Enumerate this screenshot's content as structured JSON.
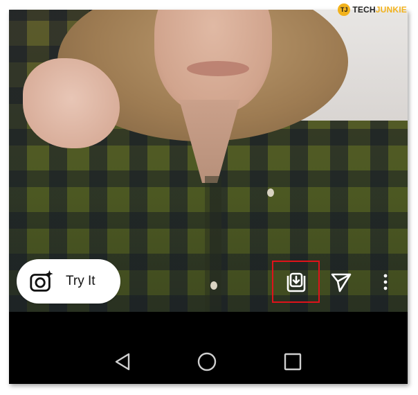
{
  "watermark": {
    "badge": "TJ",
    "prefix": "TECH",
    "suffix": "JUNKIE"
  },
  "story": {
    "try_it_label": "Try It",
    "try_it_icon": "camera-sparkle-icon",
    "actions": [
      {
        "name": "save-reel-button",
        "icon": "download-tray-icon",
        "highlighted": true
      },
      {
        "name": "share-button",
        "icon": "paper-plane-icon"
      },
      {
        "name": "more-options-button",
        "icon": "vertical-dots-icon"
      }
    ],
    "highlight_color": "#e0121a"
  },
  "system_nav": {
    "buttons": [
      "back-icon",
      "home-icon",
      "recents-icon"
    ]
  }
}
